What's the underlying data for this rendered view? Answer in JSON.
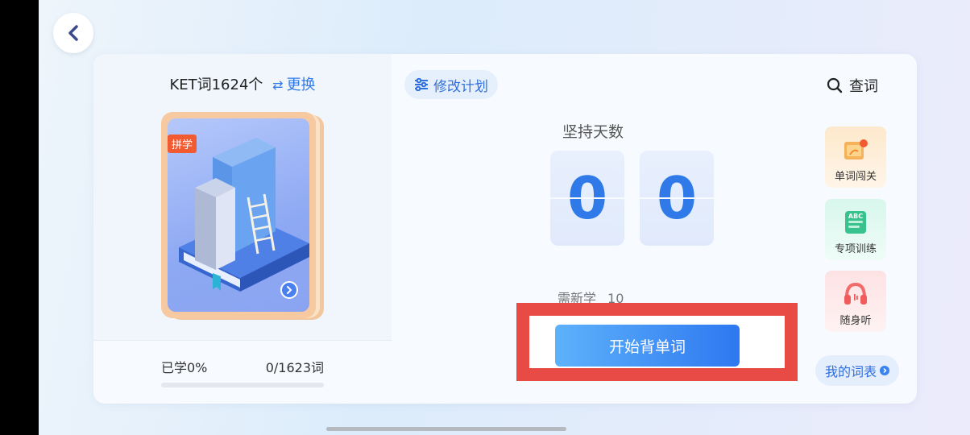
{
  "header": {
    "back_icon": "chevron-left-icon"
  },
  "book": {
    "title": "KET词1624个",
    "swap_icon": "swap-icon",
    "change_label": "更换",
    "badge": "拼学",
    "learned_label": "已学0%",
    "count_label": "0/1623词",
    "progress_percent": 0
  },
  "plan": {
    "modify_label": "修改计划",
    "persist_label": "坚持天数",
    "digits": [
      "0",
      "0"
    ],
    "need_label": "需新学",
    "need_value": "10",
    "start_label": "开始背单词"
  },
  "sidebar": {
    "search_label": "查词",
    "tiles": [
      {
        "label": "单词闯关",
        "icon": "map-flag-icon"
      },
      {
        "label": "专项训练",
        "icon": "abc-book-icon"
      },
      {
        "label": "随身听",
        "icon": "headphones-icon"
      }
    ],
    "wordlist_label": "我的词表"
  },
  "colors": {
    "accent": "#2f7ae8",
    "highlight": "#e84a45",
    "badge": "#f25b32"
  }
}
